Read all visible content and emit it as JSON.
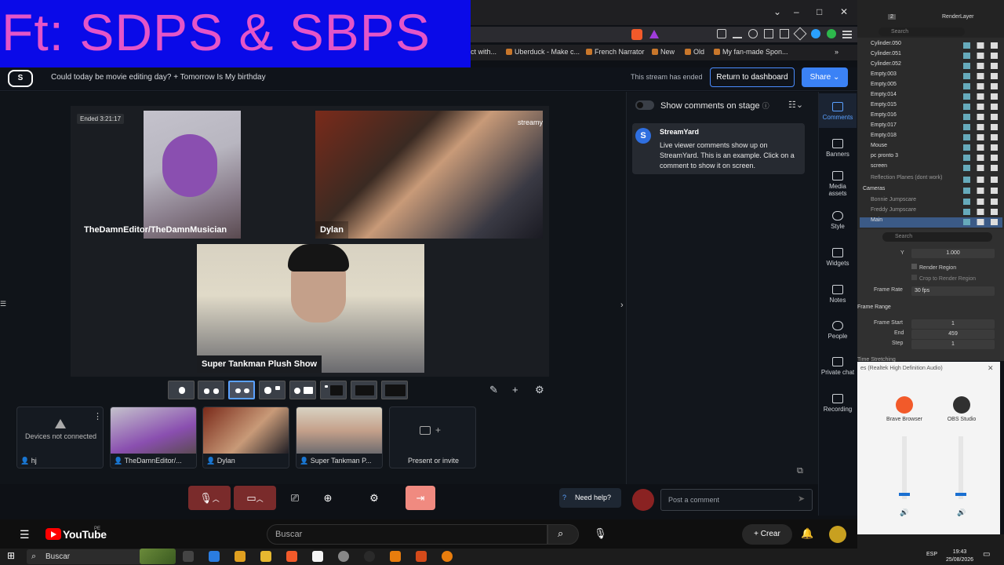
{
  "overlay": {
    "title": "Ft: SDPS & SBPS"
  },
  "browser": {
    "bookmarks": [
      {
        "label": "ct with..."
      },
      {
        "label": "Uberduck - Make c..."
      },
      {
        "label": "French Narrator"
      },
      {
        "label": "New"
      },
      {
        "label": "Old"
      },
      {
        "label": "My fan-made Spon..."
      }
    ],
    "win": {
      "min": "⌄",
      "minus": "–",
      "max": "□",
      "close": "✕"
    }
  },
  "streamyard": {
    "logo": "S",
    "title": "Could today be movie editing day? + Tomorrow Is My birthday",
    "status": "This stream has ended",
    "dashboard_btn": "Return to dashboard",
    "share_btn": "Share",
    "ended_badge": "Ended 3:21:17",
    "tiles": [
      {
        "name": "TheDamnEditor/TheDamnMusician"
      },
      {
        "name": "Dylan"
      },
      {
        "name": "Super Tankman Plush Show"
      }
    ],
    "thumbs": [
      {
        "label": "hj",
        "status": "Devices not connected"
      },
      {
        "label": "TheDamnEditor/..."
      },
      {
        "label": "Dylan"
      },
      {
        "label": "Super Tankman P..."
      },
      {
        "label": "Present or invite"
      }
    ],
    "comments": {
      "toggle_label": "Show comments on stage",
      "sender": "StreamYard",
      "message": "Live viewer comments show up on StreamYard. This is an example. Click on a comment to show it on screen.",
      "post_placeholder": "Post a comment"
    },
    "help": "Need help?",
    "sidebar": [
      {
        "label": "Comments"
      },
      {
        "label": "Banners"
      },
      {
        "label": "Media assets"
      },
      {
        "label": "Style"
      },
      {
        "label": "Widgets"
      },
      {
        "label": "Notes"
      },
      {
        "label": "People"
      },
      {
        "label": "Private chat"
      },
      {
        "label": "Recording"
      }
    ]
  },
  "blender": {
    "header": {
      "layer": "RenderLayer",
      "search": "Search",
      "num": "2"
    },
    "outliner": [
      "Cylinder.050",
      "Cylinder.051",
      "Cylinder.052",
      "Empty.003",
      "Empty.005",
      "Empty.014",
      "Empty.015",
      "Empty.016",
      "Empty.017",
      "Empty.018",
      "Mouse",
      "pc pronto 3",
      "screen",
      "Reflection Planes (dont work)",
      "Cameras",
      "Bonnie Jumpscare",
      "Freddy Jumpscare",
      "Main"
    ],
    "props": {
      "search": "Search",
      "y_label": "Y",
      "y_val": "1.000",
      "render_region": "Render Region",
      "crop_region": "Crop to Render Region",
      "framerate_label": "Frame Rate",
      "framerate_val": "30 fps",
      "range_label": "Frame Range",
      "start_label": "Frame Start",
      "start_val": "1",
      "end_label": "End",
      "end_val": "459",
      "step_label": "Step",
      "step_val": "1",
      "stretch_label": "Time Stretching"
    }
  },
  "mixer": {
    "header": "es (Realtek High Definition Audio)",
    "apps": [
      {
        "name": "Brave Browser"
      },
      {
        "name": "OBS Studio"
      }
    ]
  },
  "youtube": {
    "brand": "YouTube",
    "region": "PE",
    "search": "Buscar",
    "create": "Crear"
  },
  "taskbar": {
    "search": "Buscar",
    "lang": "ESP",
    "time": "19:43",
    "date": "25/08/2026"
  }
}
